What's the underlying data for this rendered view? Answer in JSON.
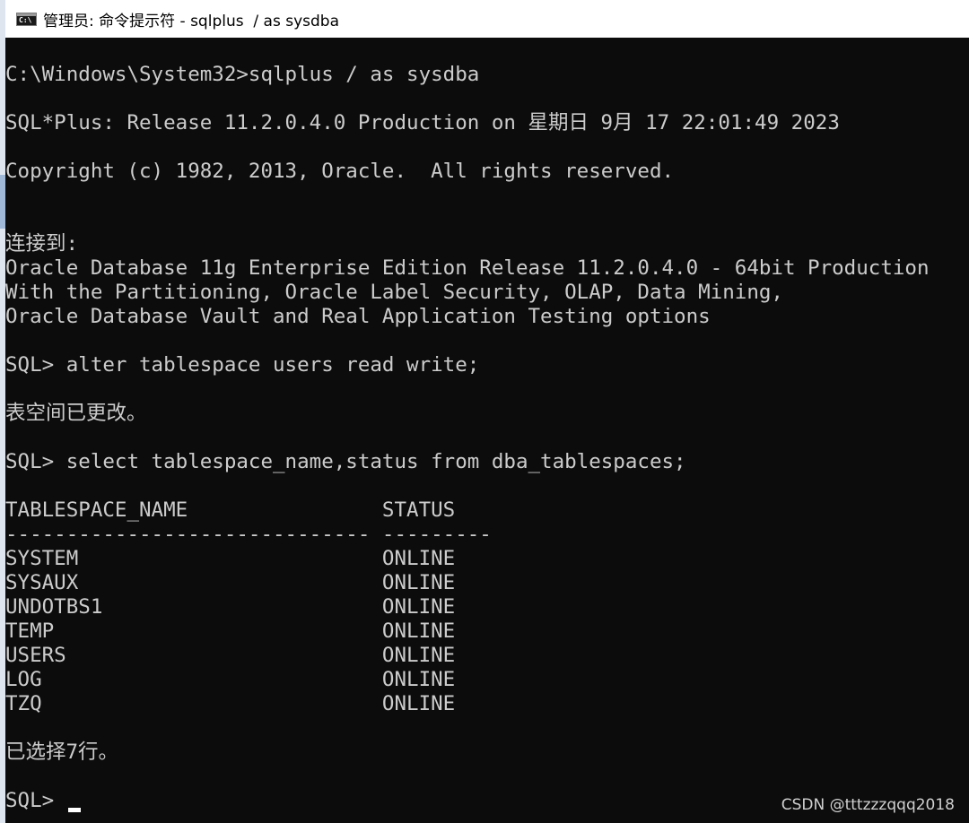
{
  "window": {
    "title": "管理员: 命令提示符 - sqlplus  / as sysdba",
    "icon": "cmd-icon"
  },
  "console": {
    "lines": [
      "C:\\Windows\\System32>sqlplus / as sysdba",
      "SQL*Plus: Release 11.2.0.4.0 Production on 星期日 9月 17 22:01:49 2023",
      "Copyright (c) 1982, 2013, Oracle.  All rights reserved.",
      "连接到:",
      "Oracle Database 11g Enterprise Edition Release 11.2.0.4.0 - 64bit Production",
      "With the Partitioning, Oracle Label Security, OLAP, Data Mining,",
      "Oracle Database Vault and Real Application Testing options",
      "SQL> alter tablespace users read write;",
      "表空间已更改。",
      "SQL> select tablespace_name,status from dba_tablespaces;",
      "TABLESPACE_NAME                STATUS",
      "------------------------------ ---------",
      "SYSTEM                         ONLINE",
      "SYSAUX                         ONLINE",
      "UNDOTBS1                       ONLINE",
      "TEMP                           ONLINE",
      "USERS                          ONLINE",
      "LOG                            ONLINE",
      "TZQ                            ONLINE",
      "已选择7行。",
      "SQL> "
    ]
  },
  "watermark": "CSDN @tttzzzqqq2018"
}
